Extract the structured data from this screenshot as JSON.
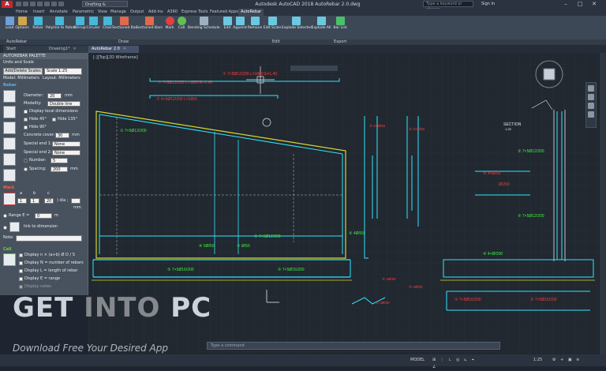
{
  "titlebar": {
    "app_icon_letter": "A",
    "workspace": "Drafting & Annotation",
    "title": "Autodesk AutoCAD 2018   AutoRebar 2.0.dwg",
    "search_placeholder": "Type a keyword or phrase",
    "user": "Sign In"
  },
  "tabs": [
    "Home",
    "Insert",
    "Annotate",
    "Parametric",
    "View",
    "Manage",
    "Output",
    "Add-ins",
    "A360",
    "Express Tools",
    "Featured Apps",
    "AutoRebar"
  ],
  "ribbon": {
    "buttons": [
      "Load",
      "Options",
      "Rebar",
      "Polyline to Rebar",
      "Stirrup",
      "Circular",
      "Chair",
      "Sectioned Bar",
      "Sectioned Bars",
      "Mark",
      "Call",
      "Bending Schedule",
      "Edit",
      "Append",
      "Remove",
      "Edit Scale",
      "Explode Selected",
      "Explode All",
      "Bar List"
    ],
    "panels": [
      "AutoRebar",
      "Draw",
      "Edit",
      "Export"
    ]
  },
  "file_tabs": [
    "Start",
    "Drawing1*",
    "AutoRebar 2.0"
  ],
  "palette": {
    "title": "AUTOREBAR PALETTE",
    "section1": "Units and Scale",
    "add_delete_scales": "Add/Delete Scales",
    "scale_value": "Scale 1:25",
    "model_units": "Model: Millimeters",
    "layout_units": "Layout: Millimeters",
    "rebar_section": "Rebar",
    "diameter_label": "Diameter:",
    "diameter_value": "20",
    "diameter_unit": "mm",
    "modality_label": "Modality:",
    "modality_value": "Double line",
    "display_local_dimensions": "Display local dimensions",
    "hide45": "Hide 45°",
    "hide135": "Hide 135°",
    "hide90": "Hide 90°",
    "concrete_cover_label": "Concrete cover:",
    "concrete_cover_value": "30",
    "concrete_cover_unit": "mm",
    "special_end1_label": "Special end 1:",
    "special_end1_value": "None",
    "special_end2_label": "Special end 2:",
    "special_end2_value": "None",
    "number_label": "Number:",
    "number_value": "5",
    "spacing_label": "Spacing:",
    "spacing_value": "200",
    "spacing_unit": "mm",
    "mark_section": "Mark",
    "mark_a": "1",
    "mark_a_col": "a",
    "mark_b": "1",
    "mark_b_col": "b",
    "mark_c": "20",
    "mark_c_col": "c",
    "mark_dia": ") dia ;",
    "mark_mm": "mm",
    "range_e_label": "Range E =",
    "range_e_value": "0",
    "range_e_unit": "m",
    "link_to_dimension": "link to dimension",
    "note_label": "Note:",
    "call_section": "Call",
    "display_formula": "Display n × (a+b) Ø D / S",
    "display_n": "Display N = number of rebars",
    "display_l": "Display L = length of rebar",
    "display_e": "Display E = range",
    "display_notes": "Display notes"
  },
  "viewport_label": "[-][Top][2D Wireframe]",
  "command_line": "Type a command",
  "status": {
    "model": "MODEL",
    "scale": "1:25"
  },
  "watermark": {
    "main_a": "GET ",
    "main_b": "INTO",
    "main_c": " PC",
    "sub": "Download Free Your Desired App"
  },
  "drawing_labels": {
    "red_top1": "⑦ 7×5Ø12/200 L=1800 E=1.40",
    "red_top2": "⑦ 4×5Ø12/200 L=1800",
    "green_main": "① 7×5Ø12/200",
    "green_bottom": "⑤ 7×5Ø16/200",
    "section_label": "SECTION",
    "section_scale": "1:25"
  }
}
